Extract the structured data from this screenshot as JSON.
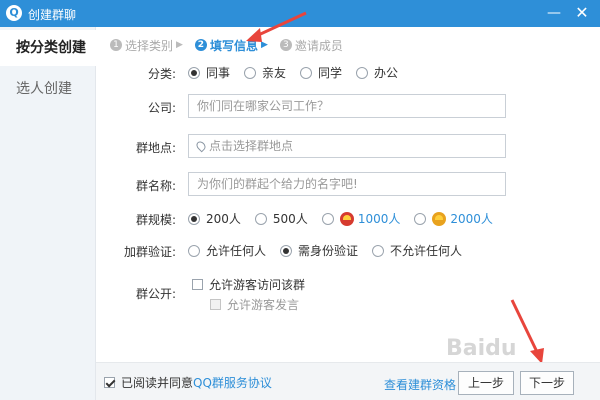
{
  "window": {
    "title": "创建群聊",
    "minimize": "—",
    "close": "✕"
  },
  "sidebar": {
    "items": [
      {
        "label": "按分类创建",
        "active": true
      },
      {
        "label": "选人创建",
        "active": false
      }
    ]
  },
  "steps": [
    {
      "num": "1",
      "label": "选择类别"
    },
    {
      "num": "2",
      "label": "填写信息",
      "active": true
    },
    {
      "num": "3",
      "label": "邀请成员"
    }
  ],
  "form": {
    "category": {
      "label": "分类:",
      "options": [
        "同事",
        "亲友",
        "同学",
        "办公"
      ],
      "selected": "同事"
    },
    "company": {
      "label": "公司:",
      "placeholder": "你们同在哪家公司工作？"
    },
    "location": {
      "label": "群地点:",
      "placeholder": "点击选择群地点"
    },
    "name": {
      "label": "群名称:",
      "placeholder": "为你们的群起个给力的名字吧!"
    },
    "size": {
      "label": "群规模:",
      "options": [
        "200人",
        "500人",
        "1000人",
        "2000人"
      ],
      "selected": "200人"
    },
    "verify": {
      "label": "加群验证:",
      "options": [
        "允许任何人",
        "需身份验证",
        "不允许任何人"
      ],
      "selected": "需身份验证"
    },
    "public": {
      "label": "群公开:",
      "allow_visit": "允许游客访问该群",
      "allow_speak": "允许游客发言"
    }
  },
  "footer": {
    "agree_prefix": "已阅读并同意",
    "agree_link": "QQ群服务协议",
    "agreed": true,
    "qualify_link": "查看建群资格",
    "prev_label": "上一步",
    "next_label": "下一步"
  },
  "colors": {
    "titlebar": "#2e8fd8",
    "accent": "#2e8fd8",
    "annotation_arrow": "#e8453c"
  }
}
